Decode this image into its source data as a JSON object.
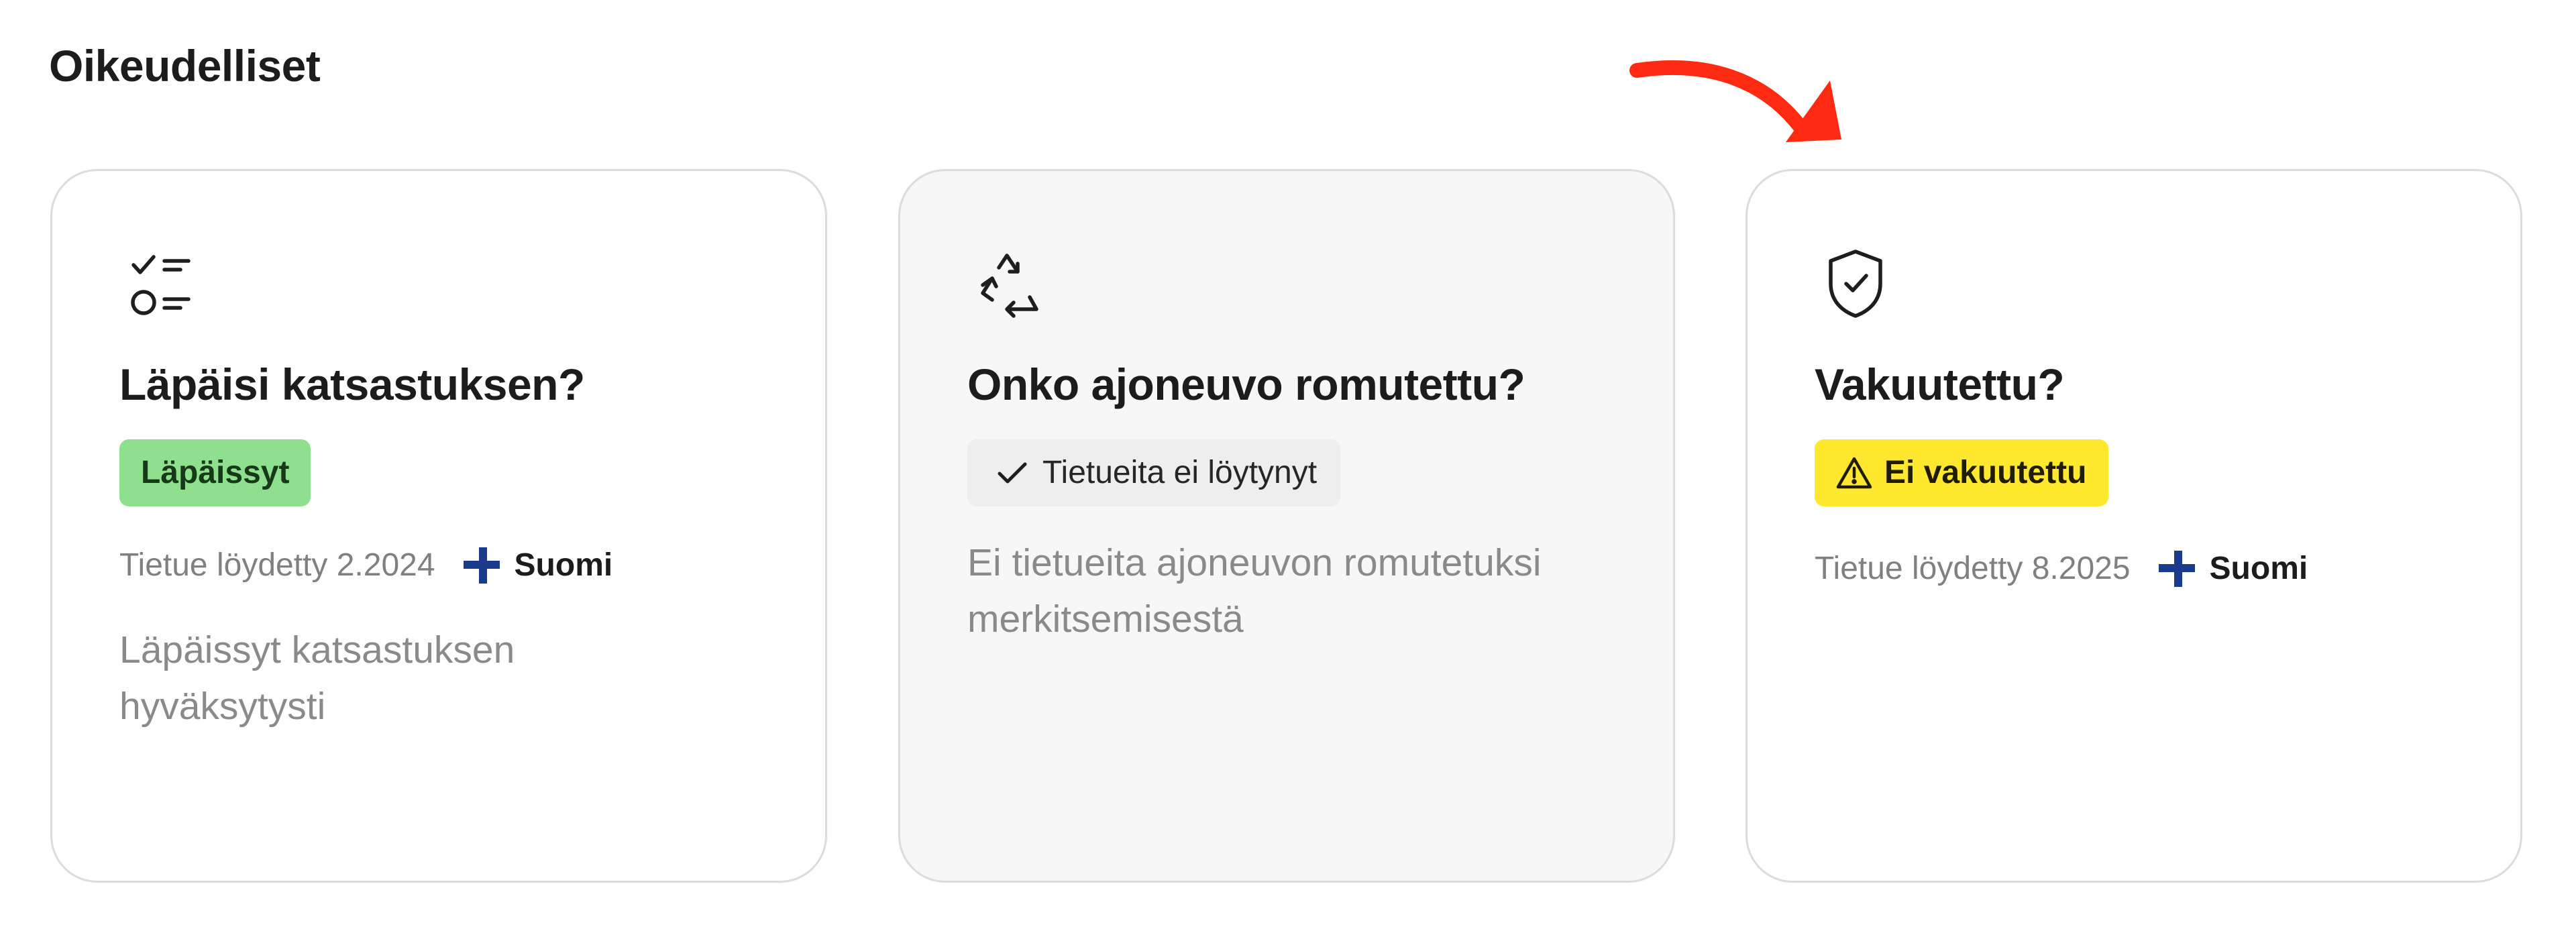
{
  "section": {
    "title": "Oikeudelliset"
  },
  "cards": [
    {
      "icon": "checklist-icon",
      "title": "Läpäisi katsastuksen?",
      "badge": {
        "label": "Läpäissyt",
        "status": "pass",
        "color": "#8ee08e"
      },
      "meta": {
        "record_text": "Tietue löydetty 2.2024",
        "country": "Suomi",
        "flag_icon": "finland-flag-icon"
      },
      "description": "Läpäissyt katsastuksen hyväksytysti"
    },
    {
      "icon": "recycle-icon",
      "title": "Onko ajoneuvo romutettu?",
      "badge": {
        "label": "Tietueita ei löytynyt",
        "status": "no-records",
        "icon": "check-icon",
        "color": "#eeeeee"
      },
      "description": "Ei tietueita ajoneuvon romutetuksi merkitsemisestä"
    },
    {
      "icon": "shield-check-icon",
      "title": "Vakuutettu?",
      "badge": {
        "label": "Ei vakuutettu",
        "status": "warning",
        "icon": "warning-triangle-icon",
        "color": "#ffe82e"
      },
      "meta": {
        "record_text": "Tietue löydetty 8.2025",
        "country": "Suomi",
        "flag_icon": "finland-flag-icon"
      }
    }
  ],
  "annotation": {
    "icon": "red-arrow-icon",
    "color": "#ff2a12"
  }
}
